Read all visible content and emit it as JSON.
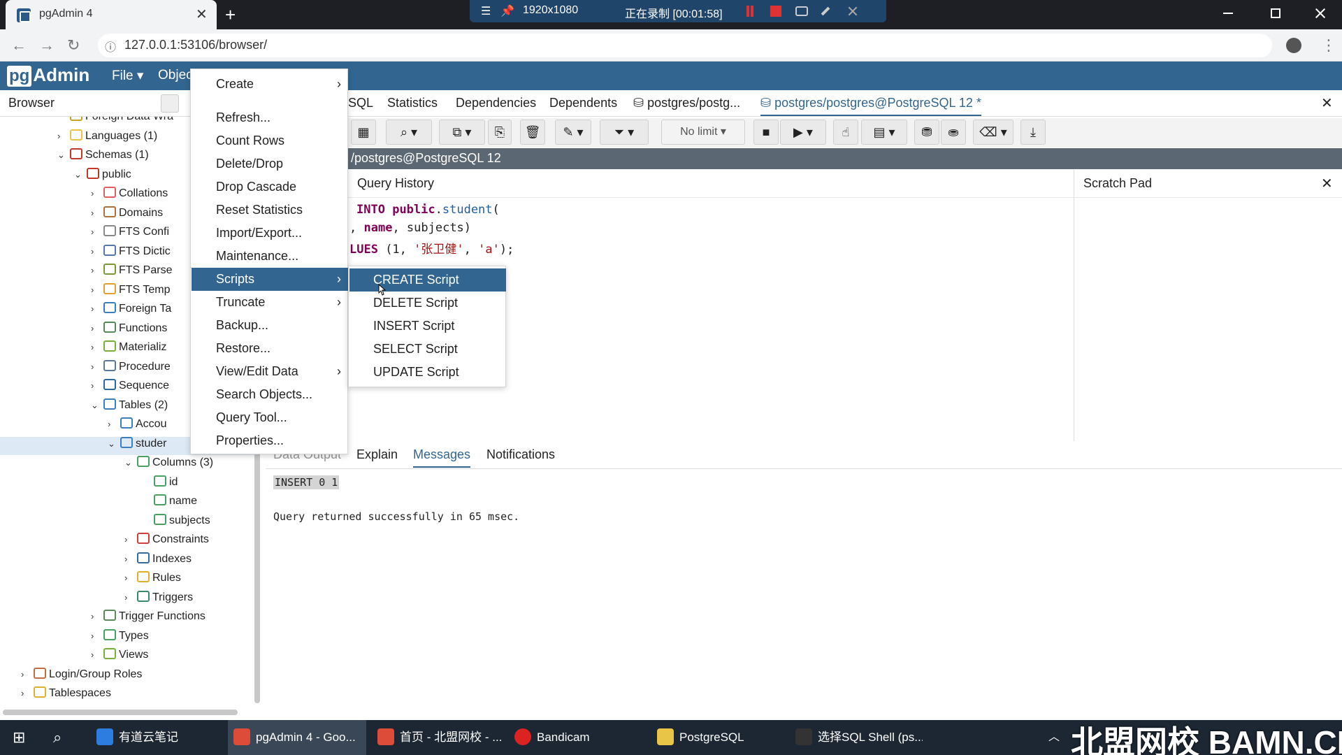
{
  "browser": {
    "tab_title": "pgAdmin 4",
    "tab_close": "✕",
    "new_tab": "+",
    "url": "127.0.0.1:53106/browser/"
  },
  "recorder": {
    "menu_icon": "☰",
    "pin_icon": "📌",
    "resolution": "1920x1080",
    "status": "正在录制 [00:01:58]"
  },
  "pgadmin": {
    "logo_pg": "pg",
    "logo_admin": "Admin",
    "menu": [
      "File ▾",
      "Objec"
    ],
    "browser_title": "Browser"
  },
  "tree": [
    {
      "label": "Foreign Data Wra",
      "icon": "foreign-data-wrapper-icon",
      "color": "#c9a227"
    },
    {
      "label": "Languages (1)",
      "icon": "language-icon",
      "color": "#e8c547"
    },
    {
      "label": "Schemas (1)",
      "icon": "schemas-icon",
      "color": "#c0392b"
    },
    {
      "label": "public",
      "icon": "schema-icon",
      "color": "#c0392b"
    },
    {
      "label": "Collations",
      "icon": "collation-icon",
      "color": "#e06060"
    },
    {
      "label": "Domains",
      "icon": "domain-icon",
      "color": "#b07040"
    },
    {
      "label": "FTS Confi",
      "icon": "fts-config-icon",
      "color": "#888"
    },
    {
      "label": "FTS Dictic",
      "icon": "fts-dictionary-icon",
      "color": "#5577aa"
    },
    {
      "label": "FTS Parse",
      "icon": "fts-parser-icon",
      "color": "#7a9a3a"
    },
    {
      "label": "FTS Temp",
      "icon": "fts-template-icon",
      "color": "#e0a030"
    },
    {
      "label": "Foreign Ta",
      "icon": "foreign-table-icon",
      "color": "#3a80c0"
    },
    {
      "label": "Functions",
      "icon": "functions-icon",
      "color": "#5a8a5a"
    },
    {
      "label": "Materializ",
      "icon": "materialized-view-icon",
      "color": "#7ab040"
    },
    {
      "label": "Procedure",
      "icon": "procedure-icon",
      "color": "#5a7a9a"
    },
    {
      "label": "Sequence",
      "icon": "sequence-icon",
      "color": "#2a6aa0"
    },
    {
      "label": "Tables (2)",
      "icon": "tables-icon",
      "color": "#3a80c0"
    },
    {
      "label": "Accou",
      "icon": "table-icon",
      "color": "#3a80c0"
    },
    {
      "label": "studer",
      "icon": "table-icon",
      "color": "#3a80c0"
    },
    {
      "label": "Columns (3)",
      "icon": "columns-icon",
      "color": "#4aa060"
    },
    {
      "label": "id",
      "icon": "column-icon",
      "color": "#4aa060"
    },
    {
      "label": "name",
      "icon": "column-icon",
      "color": "#4aa060"
    },
    {
      "label": "subjects",
      "icon": "column-icon",
      "color": "#4aa060"
    },
    {
      "label": "Constraints",
      "icon": "constraints-icon",
      "color": "#d04040"
    },
    {
      "label": "Indexes",
      "icon": "indexes-icon",
      "color": "#3a6aa0"
    },
    {
      "label": "Rules",
      "icon": "rules-icon",
      "color": "#e0b030"
    },
    {
      "label": "Triggers",
      "icon": "triggers-icon",
      "color": "#3a8a6a"
    },
    {
      "label": "Trigger Functions",
      "icon": "trigger-functions-icon",
      "color": "#5a8a5a"
    },
    {
      "label": "Types",
      "icon": "types-icon",
      "color": "#4aa060"
    },
    {
      "label": "Views",
      "icon": "views-icon",
      "color": "#7ab040"
    },
    {
      "label": "Login/Group Roles",
      "icon": "roles-icon",
      "color": "#c07040"
    },
    {
      "label": "Tablespaces",
      "icon": "tablespaces-icon",
      "color": "#e0b030"
    }
  ],
  "main_tabs": [
    "SQL",
    "Statistics",
    "Dependencies",
    "Dependents",
    "postgres/postg...",
    "postgres/postgres@PostgreSQL 12 *"
  ],
  "toolbar": {
    "limit": "No limit"
  },
  "connection": "/postgres@PostgreSQL 12",
  "query_panel": {
    "history_label": "Query History",
    "scratch_label": "Scratch Pad"
  },
  "code": {
    "line1_kw": "INTO",
    "line1_schema": "public",
    "line1_table": "student",
    "line2_a": ", ",
    "line2_name": "name",
    "line2_b": ", subjects)",
    "line3_kw": "LUES",
    "line3_rest_a": " (1, ",
    "line3_str1": "'张卫健'",
    "line3_sep": ", ",
    "line3_str2": "'a'",
    "line3_end": ");"
  },
  "output_tabs": [
    "Data Output",
    "Explain",
    "Messages",
    "Notifications"
  ],
  "messages": {
    "line1": "INSERT 0 1",
    "line2": "Query returned successfully in 65 msec."
  },
  "context_menu": [
    {
      "label": "Create",
      "submenu": true
    },
    {
      "label": "Refresh...",
      "submenu": false
    },
    {
      "label": "Count Rows",
      "submenu": false
    },
    {
      "label": "Delete/Drop",
      "submenu": false
    },
    {
      "label": "Drop Cascade",
      "submenu": false
    },
    {
      "label": "Reset Statistics",
      "submenu": false
    },
    {
      "label": "Import/Export...",
      "submenu": false
    },
    {
      "label": "Maintenance...",
      "submenu": false
    },
    {
      "label": "Scripts",
      "submenu": true,
      "highlighted": true
    },
    {
      "label": "Truncate",
      "submenu": true
    },
    {
      "label": "Backup...",
      "submenu": false
    },
    {
      "label": "Restore...",
      "submenu": false
    },
    {
      "label": "View/Edit Data",
      "submenu": true
    },
    {
      "label": "Search Objects...",
      "submenu": false
    },
    {
      "label": "Query Tool...",
      "submenu": false
    },
    {
      "label": "Properties...",
      "submenu": false
    }
  ],
  "scripts_submenu": [
    {
      "label": "CREATE Script",
      "highlighted": true
    },
    {
      "label": "DELETE Script"
    },
    {
      "label": "INSERT Script"
    },
    {
      "label": "SELECT Script"
    },
    {
      "label": "UPDATE Script"
    }
  ],
  "taskbar": {
    "items": [
      "有道云笔记",
      "pgAdmin 4 - Goo...",
      "首页 - 北盟网校 - ...",
      "Bandicam",
      "PostgreSQL",
      "选择SQL Shell (ps..."
    ],
    "watermark": "北盟网校 BAMN.CN"
  },
  "colors": {
    "accent": "#326690",
    "menu_highlight": "#326690",
    "taskbar": "#1c2733"
  }
}
